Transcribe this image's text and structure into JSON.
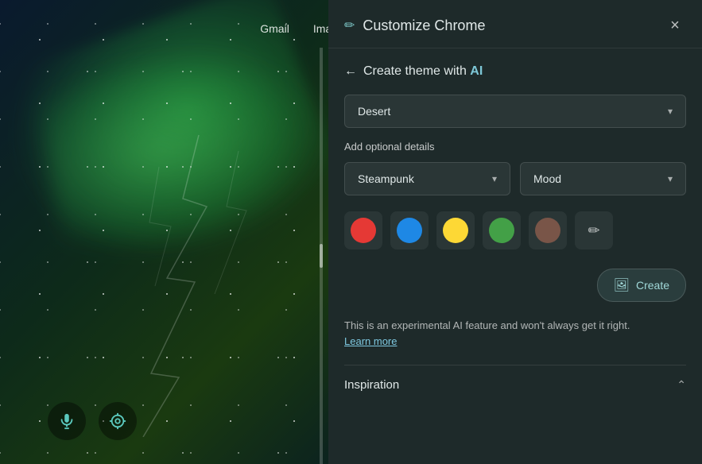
{
  "background": {
    "description": "Aurora borealis night sky"
  },
  "browser": {
    "nav_links": [
      "Gmail",
      "Images"
    ],
    "nav_icons": [
      "flask-icon",
      "grid-icon"
    ]
  },
  "bottom_controls": {
    "mic_label": "microphone",
    "camera_label": "lens"
  },
  "panel": {
    "title": "Customize Chrome",
    "close_label": "×",
    "back_nav": {
      "arrow": "←",
      "label": "Create theme with AI"
    },
    "theme_dropdown": {
      "value": "Desert",
      "chevron": "▾"
    },
    "optional_label": "Add optional details",
    "style_dropdown": {
      "value": "Steampunk",
      "chevron": "▾"
    },
    "mood_dropdown": {
      "value": "Mood",
      "chevron": "▾"
    },
    "colors": [
      {
        "id": "red",
        "hex": "#e53935"
      },
      {
        "id": "blue",
        "hex": "#1e88e5"
      },
      {
        "id": "yellow",
        "hex": "#fdd835"
      },
      {
        "id": "green",
        "hex": "#43a047"
      },
      {
        "id": "brown",
        "hex": "#795548"
      },
      {
        "id": "pen",
        "hex": null
      }
    ],
    "create_button": {
      "icon": "🖼",
      "label": "Create"
    },
    "disclaimer": {
      "text": "This is an experimental AI feature and won't always get it right.",
      "link_text": "Learn more"
    },
    "inspiration": {
      "label": "Inspiration",
      "expand_icon": "⌃"
    }
  }
}
